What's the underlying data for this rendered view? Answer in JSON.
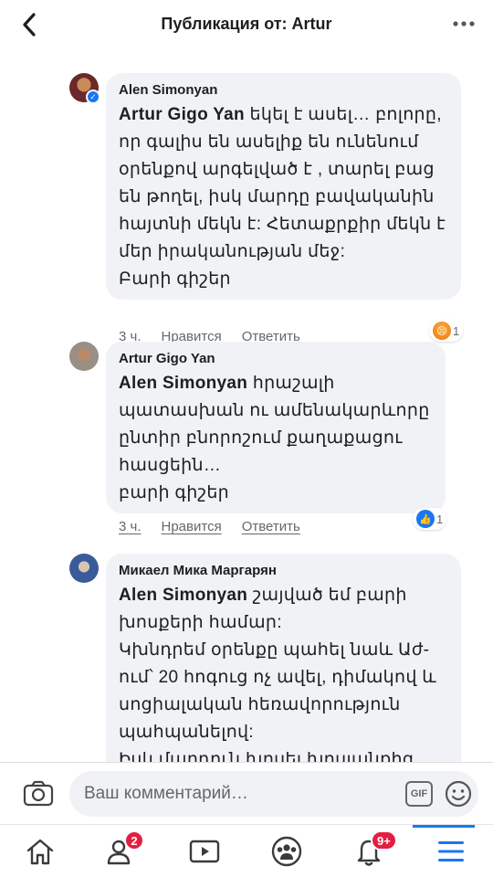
{
  "header": {
    "title": "Публикация от: Artur",
    "back_icon": "chevron-left-icon",
    "more_icon": "more-dots-icon"
  },
  "comments": [
    {
      "author": "Alen Simonyan",
      "mention": "Artur Gigo Yan",
      "lines": [
        " եկել է ասել… բոլորը,",
        "որ գալիս են ասելիք են ունենում",
        "օրենքով արգելված է , տարել բաց",
        "են թողել, իսկ մարդը բավականին",
        "հայտնի մեկն է: Հետաքրքիր մեկն է",
        "մեր իրականության մեջ:",
        "Բարի գիշեր"
      ],
      "time": "3 ч.",
      "like_label": "Нравится",
      "reply_label": "Ответить",
      "reaction": "angry",
      "reaction_count": "1",
      "verified": true
    },
    {
      "author": "Artur Gigo Yan",
      "mention": "Alen Simonyan",
      "lines": [
        " հրաշալի",
        "պատասխան ու ամենակարևորը",
        "ընտիր բնորոշում քաղաքացու",
        "հասցեին…",
        "բարի գիշեր"
      ],
      "time": "3 ч.",
      "like_label": "Нравится",
      "reply_label": "Ответить",
      "reaction": "like",
      "reaction_count": "1",
      "verified": false
    },
    {
      "author": "Микаел Мика Маргарян",
      "mention": "Alen Simonyan",
      "lines": [
        " շայված եմ բարի",
        "խոսքերի համար:",
        "Կխնդրեմ օրենքը պահել նաև Աժ-",
        "ում՝ 20 հոգուց ոչ ավել, դիմակով և",
        "սոցիալական հեռավորություն",
        "պահպանելով:",
        "Իսկ մարդուն խոսել խոսլանքից"
      ],
      "verified": false
    }
  ],
  "composer": {
    "placeholder": "Ваш комментарий…",
    "gif_label": "GIF"
  },
  "nav": {
    "friends_badge": "2",
    "notifications_badge": "9+"
  },
  "colors": {
    "accent": "#1877f2",
    "bubble": "#f0f2f5",
    "badge": "#e41e3f"
  }
}
